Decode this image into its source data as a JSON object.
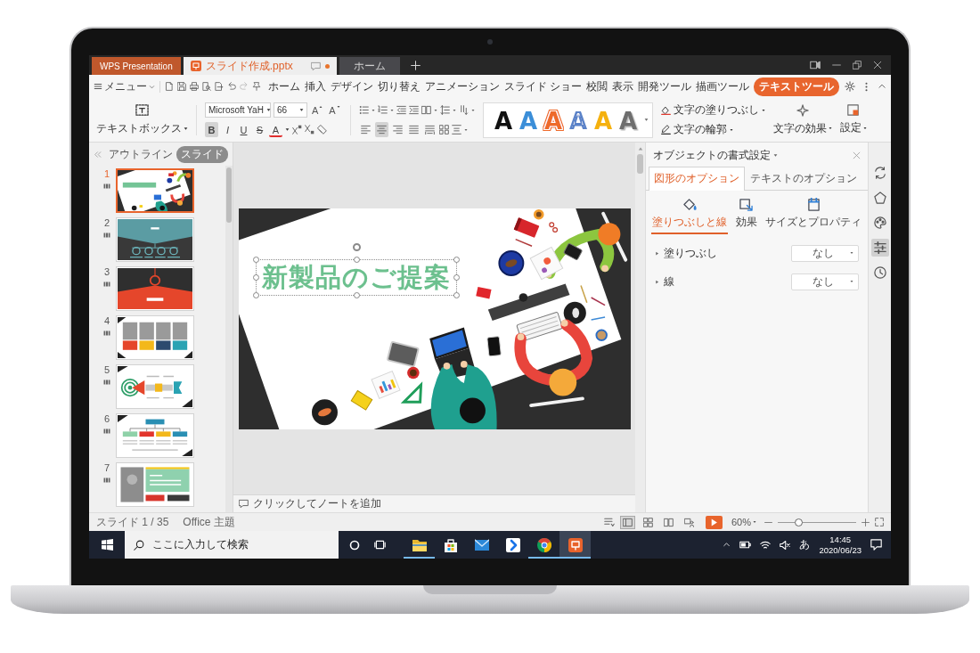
{
  "title_bar": {
    "tabs": [
      {
        "label": "WPS Presentation",
        "kind": "app",
        "selected": false,
        "modified": false
      },
      {
        "label": "スライド作成.pptx",
        "kind": "document",
        "selected": true,
        "modified": true
      },
      {
        "label": "ホーム",
        "kind": "home",
        "selected": false,
        "modified": false
      }
    ]
  },
  "menu": {
    "label": "メニュー",
    "tabs": [
      {
        "label": "ホーム",
        "selected": false
      },
      {
        "label": "挿入",
        "selected": false
      },
      {
        "label": "デザイン",
        "selected": false
      },
      {
        "label": "切り替え",
        "selected": false
      },
      {
        "label": "アニメーション",
        "selected": false
      },
      {
        "label": "スライド ショー",
        "selected": false
      },
      {
        "label": "校閲",
        "selected": false
      },
      {
        "label": "表示",
        "selected": false
      },
      {
        "label": "開発ツール",
        "selected": false
      },
      {
        "label": "描画ツール",
        "selected": false
      },
      {
        "label": "テキストツール",
        "selected": true
      }
    ]
  },
  "ribbon": {
    "textbox": "テキストボックス",
    "font_name": "Microsoft YaH",
    "font_size": "66",
    "size_buttons": [
      {
        "label": "A",
        "kind": "grow"
      },
      {
        "label": "A",
        "kind": "shrink"
      }
    ],
    "format_buttons": [
      {
        "label": "B",
        "kind": "bold",
        "selected": true
      },
      {
        "label": "I",
        "kind": "italic",
        "selected": false
      },
      {
        "label": "U",
        "kind": "underline",
        "selected": false
      },
      {
        "label": "S",
        "kind": "strike",
        "selected": false
      },
      {
        "label": "A",
        "kind": "color",
        "selected": false
      }
    ],
    "alignment": [
      {
        "kind": "left",
        "selected": false
      },
      {
        "kind": "center",
        "selected": true
      },
      {
        "kind": "right",
        "selected": false
      },
      {
        "kind": "justify",
        "selected": false
      },
      {
        "kind": "distributed",
        "selected": false
      }
    ],
    "wordart_styles": [
      {
        "letter": "A",
        "kind": "solid",
        "color": "#111111"
      },
      {
        "letter": "A",
        "kind": "solid",
        "color": "#3b8ed8"
      },
      {
        "letter": "A",
        "kind": "double_outline",
        "color": "#ee6a2c"
      },
      {
        "letter": "A",
        "kind": "outline",
        "color": "#5a82c8"
      },
      {
        "letter": "A",
        "kind": "solid",
        "color": "#f5b10f"
      },
      {
        "letter": "A",
        "kind": "shadow",
        "color": "#6e6e6e"
      }
    ],
    "text_fill": "文字の塗りつぶし",
    "text_outline": "文字の輪郭",
    "text_effect": "文字の効果",
    "settings": "設定"
  },
  "slides_panel": {
    "tabs": [
      {
        "label": "アウトライン",
        "selected": false
      },
      {
        "label": "スライド",
        "selected": true
      }
    ],
    "thumbnails": [
      {
        "number": "1",
        "kind": "title",
        "selected": true
      },
      {
        "number": "2",
        "kind": "agenda",
        "selected": false
      },
      {
        "number": "3",
        "kind": "section",
        "selected": false
      },
      {
        "number": "4",
        "kind": "photos",
        "selected": false
      },
      {
        "number": "5",
        "kind": "diagram",
        "selected": false
      },
      {
        "number": "6",
        "kind": "orgchart",
        "selected": false
      },
      {
        "number": "7",
        "kind": "profile",
        "selected": false
      }
    ]
  },
  "slide": {
    "title": "新製品のご提案",
    "title_selected": true
  },
  "notes": {
    "placeholder": "クリックしてノートを追加"
  },
  "format_pane": {
    "title": "オブジェクトの書式設定",
    "tabs": [
      {
        "label": "図形のオプション",
        "selected": true
      },
      {
        "label": "テキストのオプション",
        "selected": false
      }
    ],
    "sections": [
      {
        "label": "塗りつぶしと線",
        "kind": "fill",
        "selected": true
      },
      {
        "label": "効果",
        "kind": "effects",
        "selected": false
      },
      {
        "label": "サイズとプロパティ",
        "kind": "size",
        "selected": false
      }
    ],
    "properties": [
      {
        "label": "塗りつぶし",
        "value": "なし",
        "expanded": false
      },
      {
        "label": "線",
        "value": "なし",
        "expanded": false
      }
    ]
  },
  "side_tools": [
    {
      "kind": "replace",
      "selected": false
    },
    {
      "kind": "shapes",
      "selected": false
    },
    {
      "kind": "styles",
      "selected": false
    },
    {
      "kind": "properties",
      "selected": true
    },
    {
      "kind": "history",
      "selected": false
    }
  ],
  "status_bar": {
    "slide_counter": "スライド 1 / 35",
    "theme": "Office 主題",
    "views": [
      {
        "kind": "normal",
        "selected": true
      },
      {
        "kind": "sorter",
        "selected": false
      },
      {
        "kind": "reading",
        "selected": false
      },
      {
        "kind": "presenter",
        "selected": false
      }
    ],
    "zoom": "60%",
    "zoom_slider": {
      "level": 0.27
    }
  },
  "taskbar": {
    "search": {
      "placeholder": "ここに入力して検索"
    },
    "apps": [
      {
        "kind": "folder",
        "running": true,
        "selected": false
      },
      {
        "kind": "bag",
        "running": false,
        "selected": false
      },
      {
        "kind": "mail",
        "running": false,
        "selected": false
      },
      {
        "kind": "arrow",
        "running": false,
        "selected": false
      },
      {
        "kind": "browser",
        "running": true,
        "selected": false
      },
      {
        "kind": "presentation",
        "running": true,
        "selected": true
      }
    ],
    "ime": "あ",
    "time": "14:45",
    "date": "2020/06/23"
  }
}
